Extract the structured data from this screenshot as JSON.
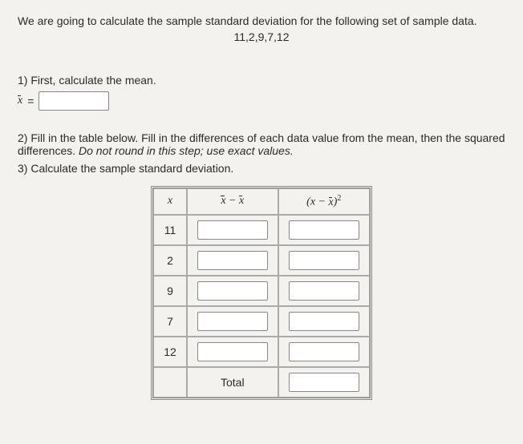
{
  "intro": "We are going to calculate the sample standard deviation for the following set of sample data.",
  "dataset": "11,2,9,7,12",
  "q1": "1) First, calculate the mean.",
  "mean_symbol": "x",
  "equals": "=",
  "q2a": "2) Fill in the table below. Fill in the differences of each data value from the mean, then the squared differences. ",
  "q2b": "Do not round in this step; use exact values.",
  "q3": "3) Calculate the sample standard deviation.",
  "headers": {
    "x": "x",
    "diff": "x − x",
    "sq_open": "(x − x)",
    "sq_exp": "2"
  },
  "rows": [
    "11",
    "2",
    "9",
    "7",
    "12"
  ],
  "total": "Total",
  "chart_data": {
    "type": "table",
    "title": "Sample standard deviation worksheet",
    "x_values": [
      11,
      2,
      9,
      7,
      12
    ],
    "columns": [
      "x",
      "x − x̄",
      "(x − x̄)^2"
    ],
    "mean_input": null,
    "diff_inputs": [
      null,
      null,
      null,
      null,
      null
    ],
    "sq_inputs": [
      null,
      null,
      null,
      null,
      null
    ],
    "total_input": null
  }
}
